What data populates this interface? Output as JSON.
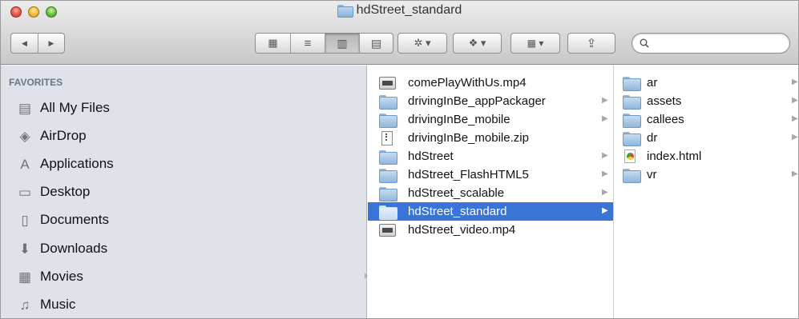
{
  "window": {
    "title": "hdStreet_standard",
    "title_icon": "folder-icon"
  },
  "toolbar": {
    "back_glyph": "◀",
    "forward_glyph": "▶",
    "view_icons": [
      "icon-view-icon",
      "list-view-icon",
      "column-view-icon",
      "coverflow-view-icon"
    ],
    "view_glyphs": [
      "▦",
      "≡",
      "▥",
      "▤"
    ],
    "active_view": "column",
    "action_glyph": "✲ ▾",
    "dropbox_glyph": "❖ ▾",
    "arrange_glyph": "▦ ▾",
    "share_glyph": "⇪",
    "search_placeholder": "",
    "search_value": ""
  },
  "sidebar": {
    "section_title": "FAVORITES",
    "items": [
      {
        "label": "All My Files",
        "icon": "all-files-icon",
        "glyph": "▤"
      },
      {
        "label": "AirDrop",
        "icon": "airdrop-icon",
        "glyph": "◈"
      },
      {
        "label": "Applications",
        "icon": "applications-icon",
        "glyph": "A"
      },
      {
        "label": "Desktop",
        "icon": "desktop-icon",
        "glyph": "▭"
      },
      {
        "label": "Documents",
        "icon": "documents-icon",
        "glyph": "▯"
      },
      {
        "label": "Downloads",
        "icon": "downloads-icon",
        "glyph": "⬇"
      },
      {
        "label": "Movies",
        "icon": "movies-icon",
        "glyph": "▦"
      },
      {
        "label": "Music",
        "icon": "music-icon",
        "glyph": "♫"
      }
    ]
  },
  "column1": {
    "items": [
      {
        "name": "comePlayWithUs.mp4",
        "type": "video",
        "has_children": false,
        "selected": false
      },
      {
        "name": "drivingInBe_appPackager",
        "type": "folder",
        "has_children": true,
        "selected": false
      },
      {
        "name": "drivingInBe_mobile",
        "type": "folder",
        "has_children": true,
        "selected": false
      },
      {
        "name": "drivingInBe_mobile.zip",
        "type": "zip",
        "has_children": false,
        "selected": false
      },
      {
        "name": "hdStreet",
        "type": "folder",
        "has_children": true,
        "selected": false
      },
      {
        "name": "hdStreet_FlashHTML5",
        "type": "folder",
        "has_children": true,
        "selected": false
      },
      {
        "name": "hdStreet_scalable",
        "type": "folder",
        "has_children": true,
        "selected": false
      },
      {
        "name": "hdStreet_standard",
        "type": "folder",
        "has_children": true,
        "selected": true
      },
      {
        "name": "hdStreet_video.mp4",
        "type": "video",
        "has_children": false,
        "selected": false
      }
    ]
  },
  "column2": {
    "items": [
      {
        "name": "ar",
        "type": "folder",
        "has_children": true
      },
      {
        "name": "assets",
        "type": "folder",
        "has_children": true
      },
      {
        "name": "callees",
        "type": "folder",
        "has_children": true
      },
      {
        "name": "dr",
        "type": "folder",
        "has_children": true
      },
      {
        "name": "index.html",
        "type": "html",
        "has_children": false
      },
      {
        "name": "vr",
        "type": "folder",
        "has_children": true
      }
    ]
  },
  "colors": {
    "selection": "#3875d7",
    "sidebar_bg": "#dfe3e9",
    "sidebar_header": "#6c7683"
  },
  "arrow_glyph": "▶"
}
